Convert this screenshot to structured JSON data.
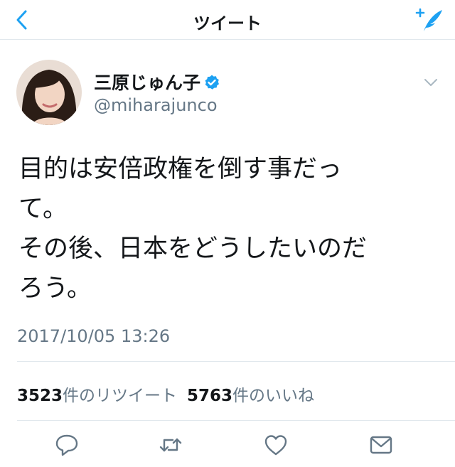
{
  "header": {
    "title": "ツイート",
    "back_icon": "chevron-left-icon",
    "compose_icon": "compose-tweet-icon"
  },
  "tweet": {
    "author": {
      "display_name": "三原じゅん子",
      "handle": "@miharajunco",
      "verified": true
    },
    "text": "目的は安倍政権を倒す事だっ\nて。\nその後、日本をどうしたいのだ\nろう。",
    "timestamp": "2017/10/05 13:26",
    "stats": {
      "retweet_count": "3523",
      "retweet_label": "件のリツイート",
      "like_count": "5763",
      "like_label": "件のいいね"
    }
  },
  "actions": [
    "reply-icon",
    "retweet-icon",
    "like-icon",
    "share-icon"
  ],
  "colors": {
    "accent": "#1da1f2",
    "text_primary": "#14171a",
    "text_secondary": "#657786",
    "divider": "#e1e8ed"
  }
}
